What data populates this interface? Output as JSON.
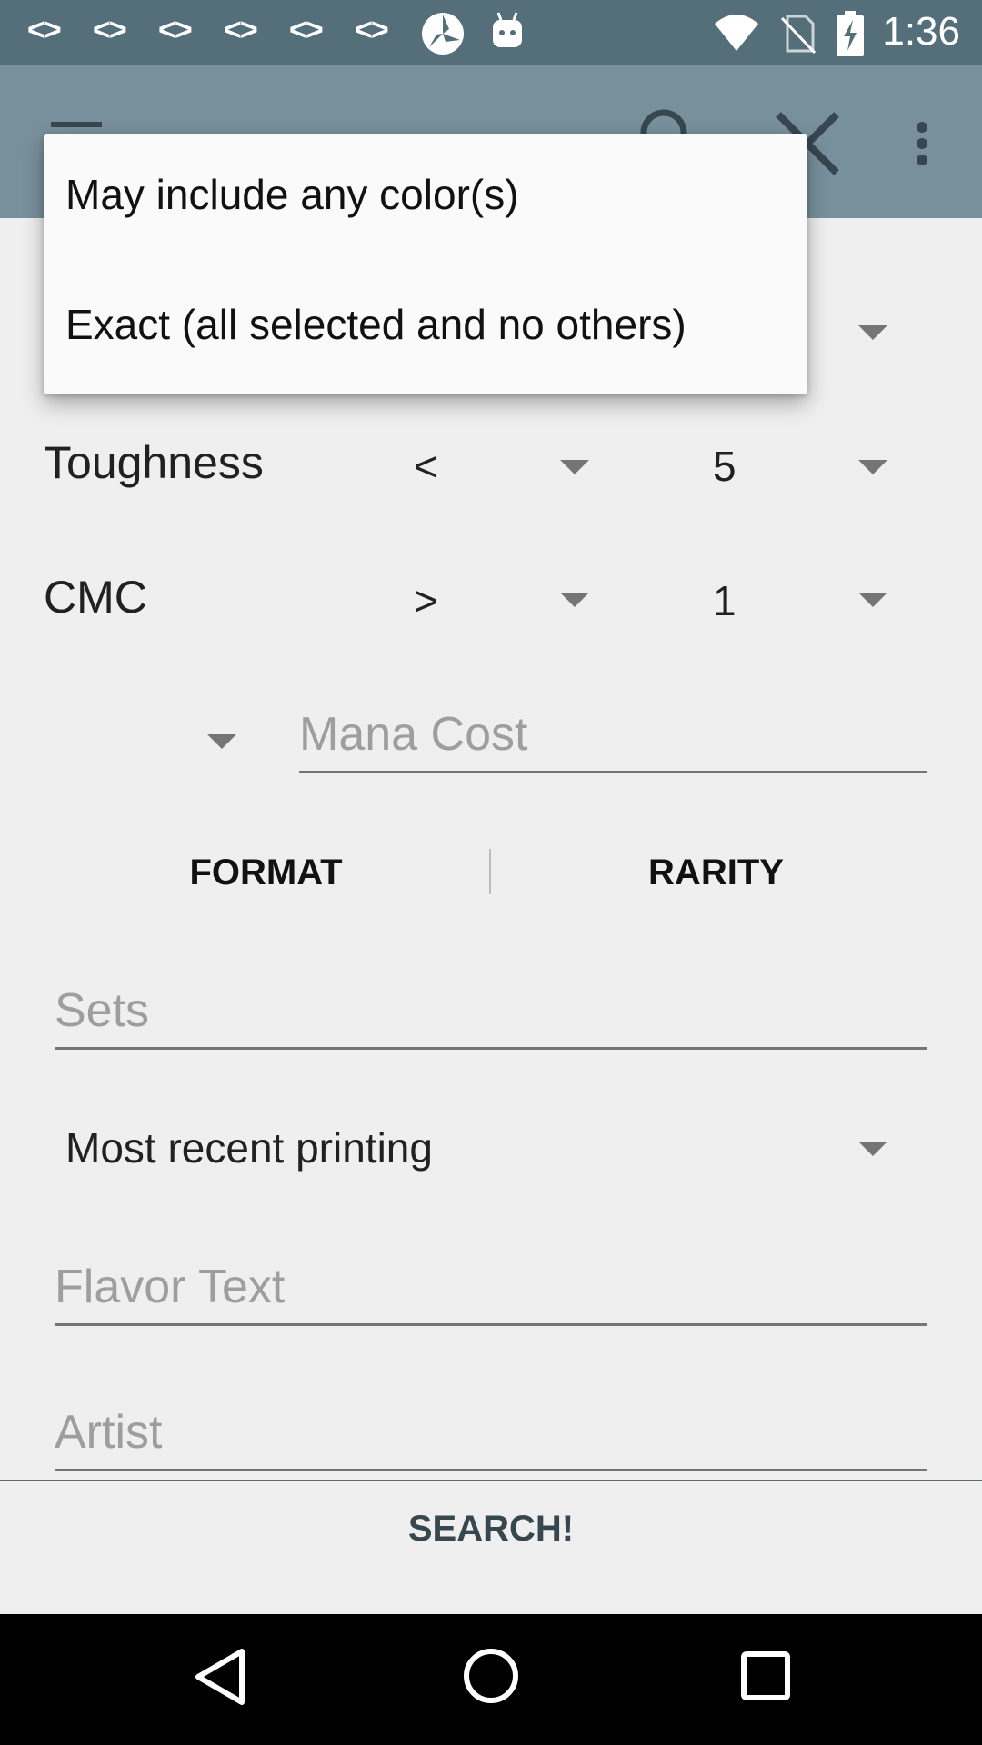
{
  "status_bar": {
    "time": "1:36",
    "notification_icons": [
      "code-icon",
      "code-icon",
      "code-icon",
      "code-icon",
      "code-icon",
      "code-icon",
      "pinwheel-icon",
      "android-icon"
    ],
    "system_icons": [
      "wifi-icon",
      "no-sim-icon",
      "battery-charging-icon"
    ]
  },
  "toolbar": {
    "menu_icon": "hamburger-menu-icon",
    "search_icon": "search-icon",
    "close_icon": "close-icon",
    "overflow_icon": "more-vert-icon"
  },
  "popup_menu": {
    "items": [
      "May include any color(s)",
      "Exact (all selected and no others)"
    ]
  },
  "filters": {
    "toughness": {
      "label": "Toughness",
      "comparator": "<",
      "value": "5"
    },
    "cmc": {
      "label": "CMC",
      "comparator": ">",
      "value": "1"
    }
  },
  "mana_cost": {
    "placeholder": "Mana Cost"
  },
  "tabs": {
    "format": "FORMAT",
    "rarity": "RARITY"
  },
  "sets": {
    "placeholder": "Sets"
  },
  "printing": {
    "selected": "Most recent printing"
  },
  "flavor_text": {
    "placeholder": "Flavor Text"
  },
  "artist": {
    "placeholder": "Artist"
  },
  "search_button": {
    "label": "SEARCH!"
  },
  "colors": {
    "status_bar": "#546e7a",
    "toolbar": "#78909c",
    "background": "#efefef",
    "accent": "#37474f"
  }
}
